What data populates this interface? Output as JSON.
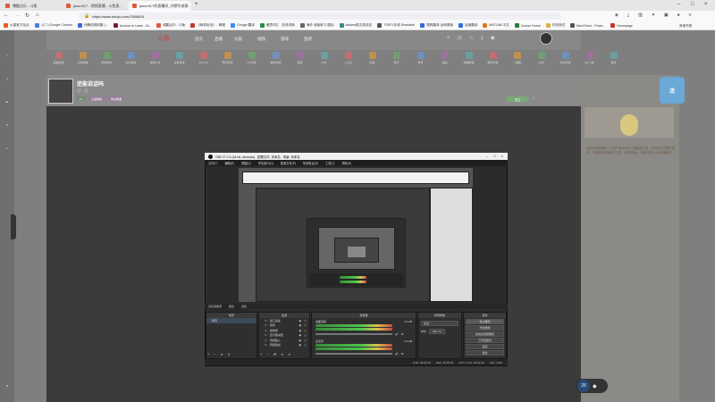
{
  "browser": {
    "tabs": [
      {
        "label": "噶酷点乐 - 斗鱼",
        "active": false,
        "color": "#e05a3a"
      },
      {
        "label": "jason917 - 视频直播 - 斗鱼直...",
        "active": false,
        "color": "#e05a3a"
      },
      {
        "label": "jason917的直播间_刘德华老歌...",
        "active": true,
        "color": "#e05a3a"
      }
    ],
    "url": "https://www.douyu.com/2008818",
    "bookmarks": [
      {
        "label": "火狐官方站点",
        "color": "#e85b1c"
      },
      {
        "label": "入门 | Google Chrome",
        "color": "#4a7ee8"
      },
      {
        "label": "伪静态规则集 (...",
        "color": "#3a6ad8"
      },
      {
        "label": "Avenue to Learn - M...",
        "color": "#7a1a3a"
      },
      {
        "label": "噶酷点乐 - 斗鱼",
        "color": "#e05a3a"
      },
      {
        "label": "《麻将玩法》 - 教程",
        "color": "#c0392b"
      },
      {
        "label": "Google 翻译",
        "color": "#4285f4"
      },
      {
        "label": "雅思词汇 - 在线词典",
        "color": "#2a8a4a"
      },
      {
        "label": "海外 阅读练习 图站",
        "color": "#666"
      },
      {
        "label": "sakana英文语法站",
        "color": "#3a8a8a"
      },
      {
        "label": "TOEFL在线 Readable",
        "color": "#555"
      },
      {
        "label": "搜狗翻译 全网搜索",
        "color": "#3a6ad8"
      },
      {
        "label": "百度翻译",
        "color": "#2f6fd6"
      },
      {
        "label": "MATLAB 中文",
        "color": "#e07a1a"
      },
      {
        "label": "Course Home",
        "color": "#2a7a3a"
      },
      {
        "label": "在线测试",
        "color": "#e0b03a"
      },
      {
        "label": "MacCheck - Powe...",
        "color": "#555"
      },
      {
        "label": "Homepage",
        "color": "#c0392b"
      }
    ],
    "other_bookmarks": "其他书签"
  },
  "site": {
    "logo": "斗鱼",
    "nav": [
      "首页",
      "直播",
      "分类",
      "视频",
      "游戏",
      "鱼吧"
    ],
    "categories": [
      "英雄联盟",
      "王者荣耀",
      "绝地求生",
      "和平精英",
      "穿越火线",
      "主机游戏",
      "DOTA2",
      "怀旧游戏",
      "CF手游",
      "单机热游",
      "颜值",
      "户外",
      "二次元",
      "科技",
      "音乐",
      "体育",
      "舞蹈",
      "英雄联盟",
      "娱乐天地",
      "一起看",
      "文化",
      "吃鸡手游",
      "QQ飞车",
      "更多"
    ],
    "streamer_name": "还能说话吗",
    "tags": [
      "主播等级",
      "粉丝徽章"
    ],
    "follow_label": "关注",
    "follow_count": "1"
  },
  "right_panel": {
    "text": "欢迎来到直播间！斗鱼严禁未成年人直播或打赏，请大家注意理性消费，不要相信任何私下交易，谨防受骗。主播请遵守斗鱼直播规范。"
  },
  "obs": {
    "title": "OBS 27.2.4 (64-bit, windows) - 配置文件: 未命名 - 场景: 未命名",
    "menu": [
      "文件(F)",
      "编辑(E)",
      "视图(V)",
      "停靠窗口(D)",
      "配置文件(P)",
      "场景集合(S)",
      "工具(T)",
      "帮助(H)"
    ],
    "source_bar": [
      "没有选择源",
      "属性",
      "滤镜"
    ],
    "docks": {
      "scenes": "场景",
      "sources": "来源",
      "mixer": "混音器",
      "transitions": "转场特效",
      "controls": "控件"
    },
    "scene_item": "场景",
    "sources": [
      "窗口采集",
      "游戏",
      "媒体源",
      "显示器采集",
      "音频输入",
      "音频输出"
    ],
    "mixer": [
      {
        "name": "桌面音频",
        "db": "0.0 dB"
      },
      {
        "name": "麦克风",
        "db": "0.0 dB"
      }
    ],
    "transition": {
      "label": "淡出",
      "duration_label": "时长",
      "duration": "300 ms"
    },
    "controls": [
      "停止推流",
      "开始录制",
      "启动虚拟摄像机",
      "工作室模式",
      "设置",
      "退出"
    ],
    "status": [
      "LIVE: 00:00:18",
      "REC: 00:00:00",
      "CPU: 3.4%, 30.00 fps",
      "kb/s: 2430"
    ]
  },
  "viewers": {
    "count": "28"
  }
}
